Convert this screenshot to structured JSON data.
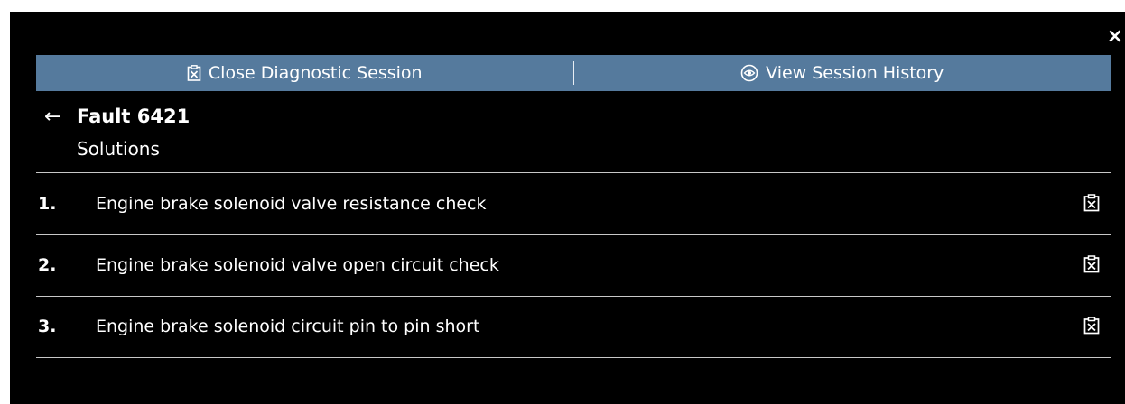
{
  "window": {
    "close_glyph": "×"
  },
  "action_bar": {
    "close_session_label": "Close Diagnostic Session",
    "close_session_icon": "clipboard-x-icon",
    "view_history_label": "View Session History",
    "view_history_icon": "eye-circle-icon",
    "background": "#557a9d"
  },
  "header": {
    "back_glyph": "←",
    "title": "Fault 6421",
    "subtitle": "Solutions"
  },
  "solutions": [
    {
      "number": "1.",
      "label": "Engine brake solenoid valve resistance check",
      "icon": "clipboard-x-icon"
    },
    {
      "number": "2.",
      "label": "Engine brake solenoid valve open circuit check",
      "icon": "clipboard-x-icon"
    },
    {
      "number": "3.",
      "label": "Engine brake solenoid circuit pin to pin short",
      "icon": "clipboard-x-icon"
    }
  ]
}
